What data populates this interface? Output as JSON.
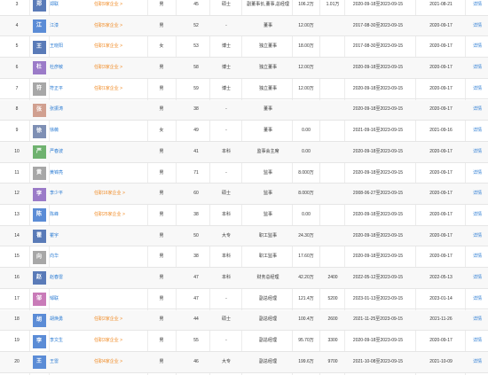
{
  "colors": {
    "link": "#2a7bd3",
    "tenure": "#f08a24"
  },
  "rows": [
    {
      "idx": "3",
      "avatar": "郑",
      "avatar_color": "#5a7bb8",
      "name": "郑联",
      "tenure": "任职9家企业 >",
      "gender": "男",
      "age": "45",
      "edu": "硕士",
      "title": "副董事长,董事,总经理",
      "salary": "106.2万",
      "shares": "1.01万",
      "term": "2020-09-18至2023-09-15",
      "date": "2021-08-21",
      "detail": "详情"
    },
    {
      "idx": "4",
      "avatar": "江",
      "avatar_color": "#5b8cd6",
      "name": "江漆",
      "tenure": "任职5家企业 >",
      "gender": "男",
      "age": "52",
      "edu": "-",
      "title": "董事",
      "salary": "12.00万",
      "shares": "",
      "term": "2017-08-30至2023-09-15",
      "date": "2020-09-17",
      "detail": "详情"
    },
    {
      "idx": "5",
      "avatar": "王",
      "avatar_color": "#5a7bb8",
      "name": "王晓阳",
      "tenure": "任职1家企业 >",
      "gender": "女",
      "age": "53",
      "edu": "博士",
      "title": "独立董事",
      "salary": "18.00万",
      "shares": "",
      "term": "2017-08-30至2023-09-15",
      "date": "2020-09-17",
      "detail": "详情"
    },
    {
      "idx": "6",
      "avatar": "杜",
      "avatar_color": "#9b7bc8",
      "name": "杜彦敏",
      "tenure": "任职3家企业 >",
      "gender": "男",
      "age": "58",
      "edu": "博士",
      "title": "独立董事",
      "salary": "12.00万",
      "shares": "",
      "term": "2020-09-18至2023-09-15",
      "date": "2020-09-17",
      "detail": "详情"
    },
    {
      "idx": "7",
      "avatar": "符",
      "avatar_color": "#a7a7a7",
      "name": "符正平",
      "tenure": "任职1家企业 >",
      "gender": "男",
      "age": "59",
      "edu": "博士",
      "title": "独立董事",
      "salary": "12.00万",
      "shares": "",
      "term": "2020-09-18至2023-09-15",
      "date": "2020-09-17",
      "detail": "详情"
    },
    {
      "idx": "8",
      "avatar": "张",
      "avatar_color": "#d1a090",
      "name": "张振涛",
      "tenure": "",
      "gender": "男",
      "age": "38",
      "edu": "-",
      "title": "董事",
      "salary": "",
      "shares": "",
      "term": "2020-09-18至2023-09-15",
      "date": "2020-09-17",
      "detail": "详情"
    },
    {
      "idx": "9",
      "avatar": "徐",
      "avatar_color": "#7e8fb4",
      "name": "徐薇",
      "tenure": "",
      "gender": "女",
      "age": "49",
      "edu": "-",
      "title": "董事",
      "salary": "0.00",
      "shares": "",
      "term": "2021-09-16至2023-09-15",
      "date": "2021-09-16",
      "detail": "详情"
    },
    {
      "idx": "10",
      "avatar": "严",
      "avatar_color": "#6fb26f",
      "name": "严春波",
      "tenure": "",
      "gender": "男",
      "age": "41",
      "edu": "本科",
      "title": "监事会主席",
      "salary": "0.00",
      "shares": "",
      "term": "2020-09-18至2023-09-15",
      "date": "2020-09-17",
      "detail": "详情"
    },
    {
      "idx": "11",
      "avatar": "黄",
      "avatar_color": "#a7a7a7",
      "name": "黄锦亮",
      "tenure": "",
      "gender": "男",
      "age": "71",
      "edu": "-",
      "title": "监事",
      "salary": "8.000万",
      "shares": "",
      "term": "2020-09-18至2023-09-15",
      "date": "2020-09-17",
      "detail": "详情"
    },
    {
      "idx": "12",
      "avatar": "李",
      "avatar_color": "#9b7bc8",
      "name": "李少平",
      "tenure": "任职16家企业 >",
      "gender": "男",
      "age": "60",
      "edu": "硕士",
      "title": "监事",
      "salary": "8.000万",
      "shares": "",
      "term": "2008-06-27至2023-09-15",
      "date": "2020-09-17",
      "detail": "详情"
    },
    {
      "idx": "13",
      "avatar": "陈",
      "avatar_color": "#5b8cd6",
      "name": "陈峰",
      "tenure": "任职25家企业 >",
      "gender": "男",
      "age": "38",
      "edu": "本科",
      "title": "监事",
      "salary": "0.00",
      "shares": "",
      "term": "2020-09-18至2023-09-15",
      "date": "2020-09-17",
      "detail": "详情"
    },
    {
      "idx": "14",
      "avatar": "瞿",
      "avatar_color": "#5a7bb8",
      "name": "瞿宇",
      "tenure": "",
      "gender": "男",
      "age": "50",
      "edu": "大专",
      "title": "职工监事",
      "salary": "24.30万",
      "shares": "",
      "term": "2020-09-18至2023-09-15",
      "date": "2020-09-17",
      "detail": "详情"
    },
    {
      "idx": "15",
      "avatar": "向",
      "avatar_color": "#a7a7a7",
      "name": "向华",
      "tenure": "",
      "gender": "男",
      "age": "38",
      "edu": "本科",
      "title": "职工监事",
      "salary": "17.60万",
      "shares": "",
      "term": "2020-09-18至2023-09-15",
      "date": "2020-09-17",
      "detail": "详情"
    },
    {
      "idx": "16",
      "avatar": "赵",
      "avatar_color": "#5a7bb8",
      "name": "赵春雷",
      "tenure": "",
      "gender": "男",
      "age": "47",
      "edu": "本科",
      "title": "财务总经理",
      "salary": "42.20万",
      "shares": "2400",
      "term": "2022-05-12至2023-09-15",
      "date": "2022-05-13",
      "detail": "详情"
    },
    {
      "idx": "17",
      "avatar": "邹",
      "avatar_color": "#c97bb8",
      "name": "邹联",
      "tenure": "",
      "gender": "男",
      "age": "47",
      "edu": "-",
      "title": "副总经理",
      "salary": "121.4万",
      "shares": "5200",
      "term": "2023-01-13至2023-09-15",
      "date": "2023-01-14",
      "detail": "详情"
    },
    {
      "idx": "18",
      "avatar": "胡",
      "avatar_color": "#5b8cd6",
      "name": "胡焕勇",
      "tenure": "任职2家企业 >",
      "gender": "男",
      "age": "44",
      "edu": "硕士",
      "title": "副总经理",
      "salary": "100.4万",
      "shares": "2600",
      "term": "2021-11-25至2023-09-15",
      "date": "2021-11-26",
      "detail": "详情"
    },
    {
      "idx": "19",
      "avatar": "李",
      "avatar_color": "#5b8cd6",
      "name": "李文生",
      "tenure": "任职3家企业 >",
      "gender": "男",
      "age": "55",
      "edu": "-",
      "title": "副总经理",
      "salary": "95.70万",
      "shares": "3300",
      "term": "2020-09-18至2023-09-15",
      "date": "2020-09-17",
      "detail": "详情"
    },
    {
      "idx": "20",
      "avatar": "王",
      "avatar_color": "#5b8cd6",
      "name": "王雷",
      "tenure": "任职4家企业 >",
      "gender": "男",
      "age": "46",
      "edu": "大专",
      "title": "副总经理",
      "salary": "199.6万",
      "shares": "9700",
      "term": "2021-10-08至2023-09-15",
      "date": "2021-10-09",
      "detail": "详情"
    }
  ]
}
